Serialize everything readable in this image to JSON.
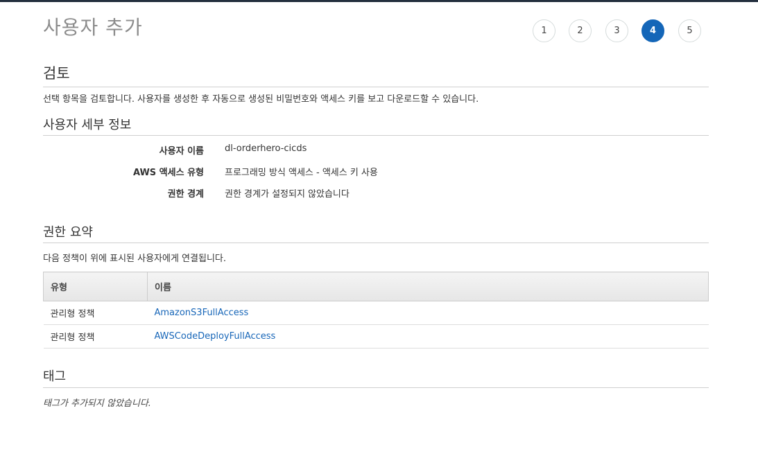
{
  "header": {
    "title": "사용자 추가"
  },
  "steps": [
    {
      "label": "1",
      "active": false
    },
    {
      "label": "2",
      "active": false
    },
    {
      "label": "3",
      "active": false
    },
    {
      "label": "4",
      "active": true
    },
    {
      "label": "5",
      "active": false
    }
  ],
  "review": {
    "heading": "검토",
    "description": "선택 항목을 검토합니다. 사용자를 생성한 후 자동으로 생성된 비밀번호와 액세스 키를 보고 다운로드할 수 있습니다."
  },
  "user_details": {
    "heading": "사용자 세부 정보",
    "rows": [
      {
        "label": "사용자 이름",
        "value": "dl-orderhero-cicds"
      },
      {
        "label": "AWS 액세스 유형",
        "value": "프로그래밍 방식 액세스 - 액세스 키 사용"
      },
      {
        "label": "권한 경계",
        "value": "권한 경계가 설정되지 않았습니다"
      }
    ]
  },
  "permissions": {
    "heading": "권한 요약",
    "description": "다음 정책이 위에 표시된 사용자에게 연결됩니다.",
    "columns": [
      "유형",
      "이름"
    ],
    "rows": [
      {
        "type": "관리형 정책",
        "name": "AmazonS3FullAccess"
      },
      {
        "type": "관리형 정책",
        "name": "AWSCodeDeployFullAccess"
      }
    ]
  },
  "tags": {
    "heading": "태그",
    "empty_text": "태그가 추가되지 않았습니다."
  },
  "colors": {
    "accent": "#1466b8",
    "link": "#1766b8",
    "topbar": "#232f3e"
  }
}
